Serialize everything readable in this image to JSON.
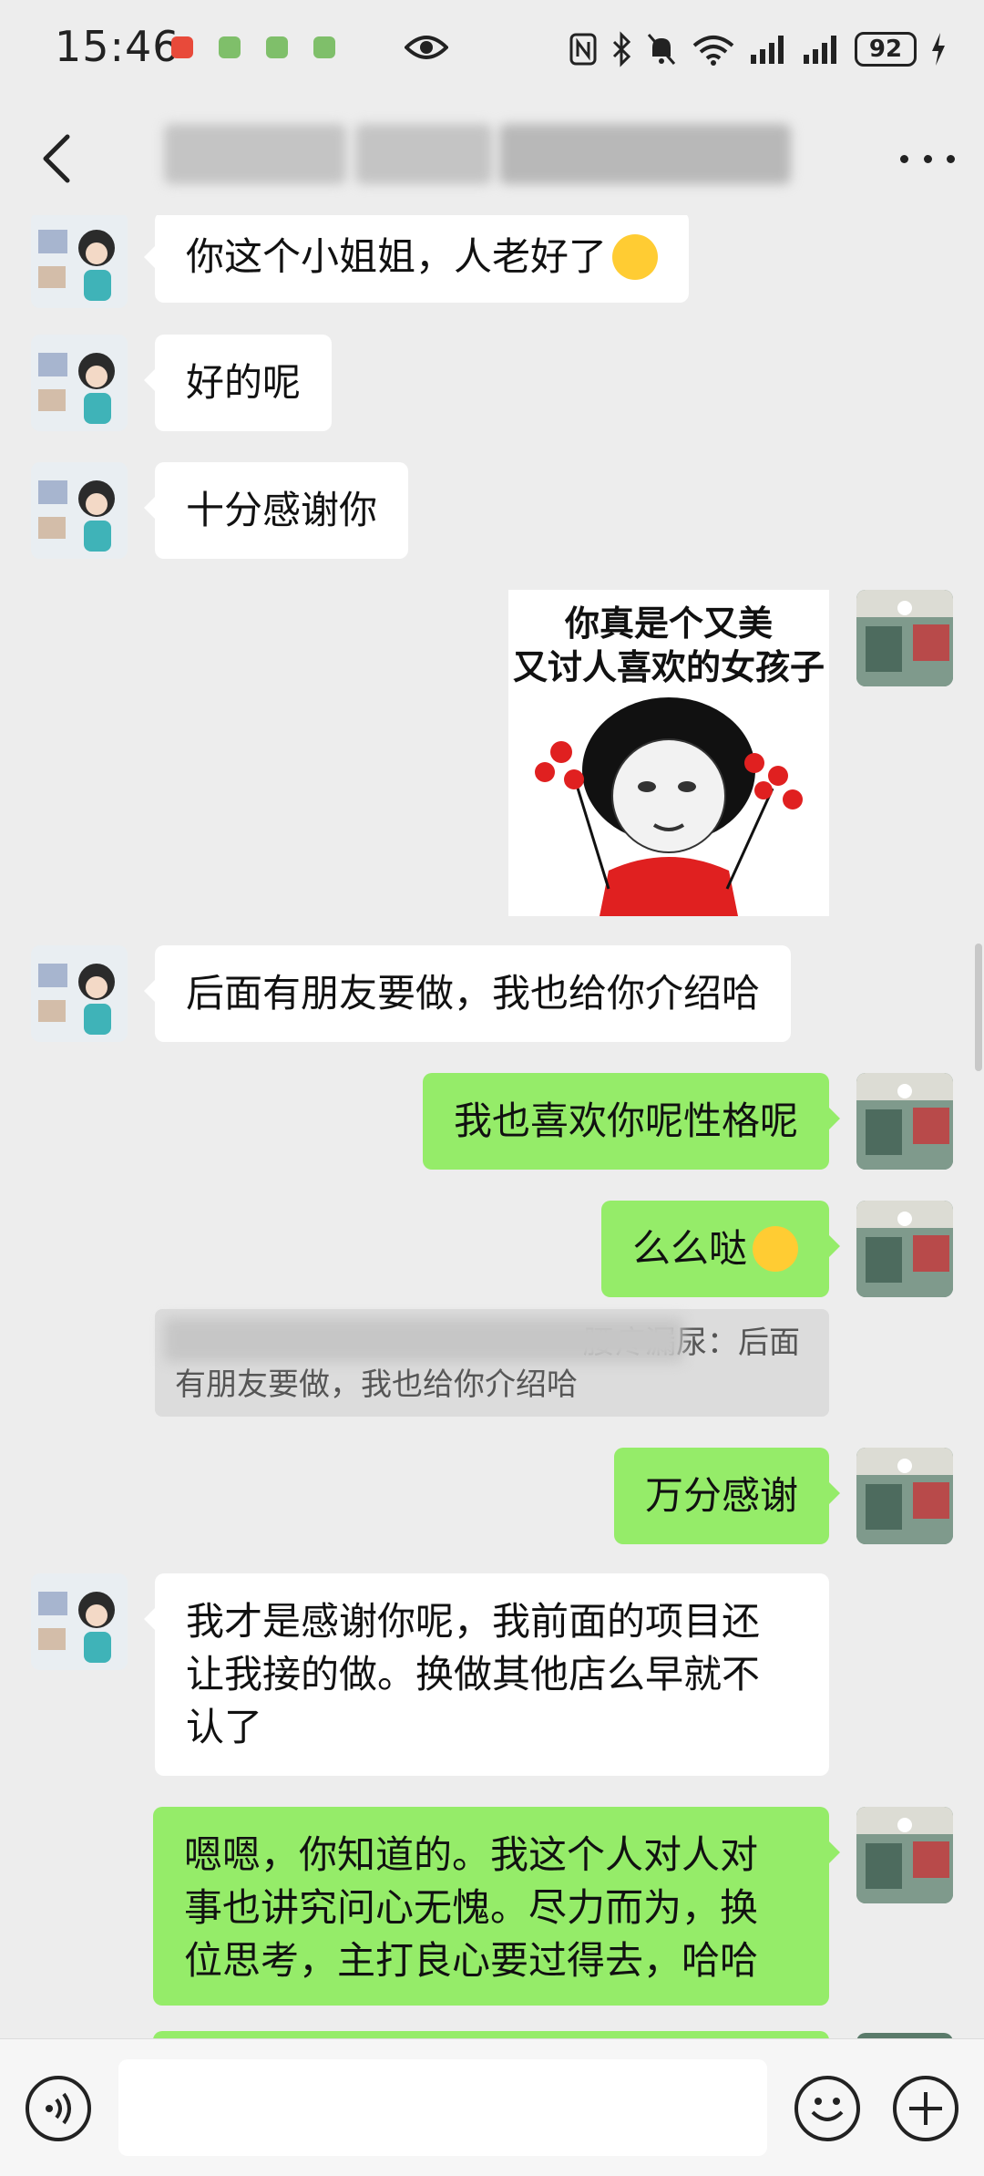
{
  "status_bar": {
    "time": "15:46",
    "battery": "92"
  },
  "header": {
    "title": ""
  },
  "messages": [
    {
      "text": "你这个小姐姐，人老好了"
    },
    {
      "text": "好的呢"
    },
    {
      "text": "十分感谢你"
    },
    {
      "sticker_line1": "你真是个又美",
      "sticker_line2": "又讨人喜欢的女孩子"
    },
    {
      "text": "后面有朋友要做，我也给你介绍哈"
    },
    {
      "text": "我也喜欢你呢性格呢"
    },
    {
      "text": "么么哒"
    },
    {
      "quote_line1": "腰疼漏尿：后面",
      "quote_line2": "有朋友要做，我也给你介绍哈"
    },
    {
      "text": "万分感谢"
    },
    {
      "text": "我才是感谢你呢，我前面的项目还\n让我接的做。换做其他店么早就不\n认了"
    },
    {
      "text": "嗯嗯，你知道的。我这个人对人对\n事也讲究问心无愧。尽力而为，换\n位思考，主打良心要过得去，哈哈"
    }
  ],
  "input_bar": {
    "placeholder": ""
  },
  "colors": {
    "background": "#ededed",
    "bubble_self": "#95ec69",
    "bubble_peer": "#ffffff",
    "quote_bg": "#dcdcdc"
  },
  "icons": {
    "back": "chevron-left-icon",
    "more": "more-icon",
    "voice": "voice-icon",
    "emoji": "smiley-icon",
    "add": "plus-icon"
  }
}
